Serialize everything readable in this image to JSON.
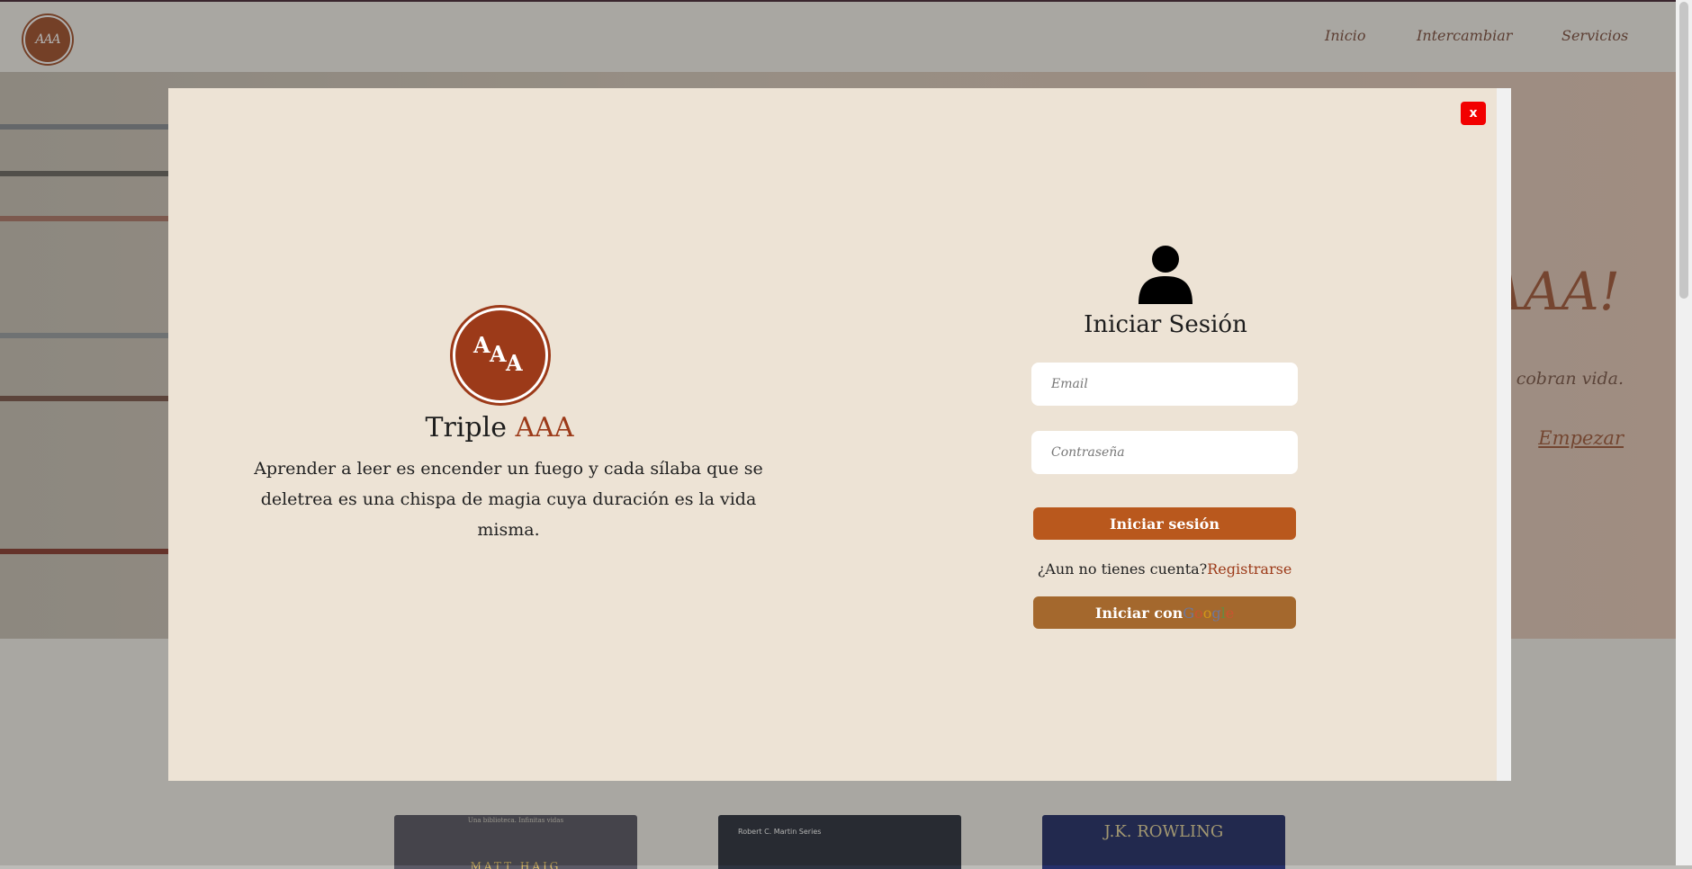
{
  "header": {
    "logo_text": "AAA",
    "nav": [
      "Inicio",
      "Intercambiar",
      "Servicios"
    ]
  },
  "hero": {
    "title_fragment": "AAA!",
    "subtitle_fragment": "ias cobran vida.",
    "cta": "Empezar"
  },
  "books": [
    {
      "top_text": "Una biblioteca. Infinitas vidas",
      "author": "MATT HAIG"
    },
    {
      "top_text": "Robert C. Martin Series",
      "author": ""
    },
    {
      "top_text": "",
      "author": "J.K. ROWLING"
    }
  ],
  "modal": {
    "close_label": "x",
    "brand": {
      "logo_letters": [
        "A",
        "A",
        "A"
      ],
      "name": "Triple",
      "name_accent": "AAA",
      "quote": "Aprender a leer es encender un fuego y cada sílaba que se deletrea es una chispa de magia cuya duración es la vida misma."
    },
    "login": {
      "title": "Iniciar Sesión",
      "email_placeholder": "Email",
      "password_placeholder": "Contraseña",
      "login_button": "Iniciar sesión",
      "register_prompt": "¿Aun no tienes cuenta?",
      "register_link": "Registrarse",
      "google_button_prefix": "Iniciar con",
      "google_word": "Google"
    }
  },
  "colors": {
    "brand": "#9c3a19",
    "login_button": "#b9581d",
    "google_button": "#a4682d",
    "close_button": "#f20000",
    "modal_bg": "#ede3d5"
  }
}
